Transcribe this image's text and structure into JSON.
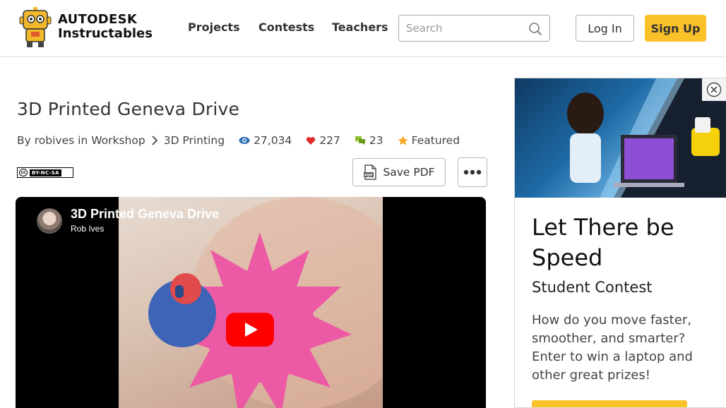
{
  "header": {
    "brand": "AUTODESK",
    "product": "Instructables",
    "nav": [
      "Projects",
      "Contests",
      "Teachers"
    ],
    "search_placeholder": "Search",
    "login_label": "Log In",
    "signup_label": "Sign Up"
  },
  "article": {
    "title": "3D Printed Geneva Drive",
    "by_prefix": "By",
    "author": "robives",
    "in_word": "in",
    "category": "Workshop",
    "subcategory": "3D Printing",
    "views": "27,034",
    "favorites": "227",
    "comments": "23",
    "featured": "Featured",
    "license_text": "BY-NC-SA",
    "save_pdf_label": "Save PDF"
  },
  "video": {
    "title": "3D Printed Geneva Drive",
    "channel": "Rob Ives"
  },
  "ad": {
    "headline": "Let There be Speed",
    "subheadline": "Student Contest",
    "body": "How do you move faster, smoother, and smarter? Enter to win a laptop and other great prizes!"
  },
  "colors": {
    "accent": "#fac129",
    "heart": "#e12b2b",
    "eye": "#2f6fb3",
    "comment": "#8fbf2a",
    "star": "#f5a623",
    "play": "#ff0000"
  },
  "icons": [
    "robot-logo-icon",
    "search-icon",
    "chevron-right-icon",
    "eye-icon",
    "heart-icon",
    "comment-icon",
    "star-icon",
    "pdf-icon",
    "more-icon",
    "play-icon",
    "close-icon"
  ]
}
